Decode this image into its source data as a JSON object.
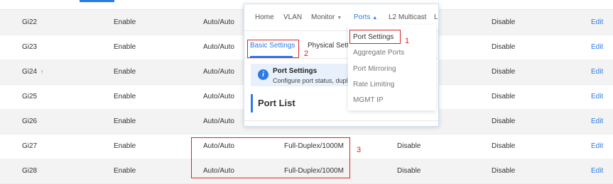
{
  "rows": [
    {
      "port": "Gi22",
      "enable": "Enable",
      "speed": "Auto/Auto",
      "duplex": "",
      "flow": "",
      "status": "Disable",
      "action": "Edit"
    },
    {
      "port": "Gi23",
      "enable": "Enable",
      "speed": "Auto/Auto",
      "duplex": "",
      "flow": "",
      "status": "Disable",
      "action": "Edit"
    },
    {
      "port": "Gi24",
      "enable": "Enable",
      "speed": "Auto/Auto",
      "duplex": "",
      "flow": "",
      "status": "Disable",
      "action": "Edit",
      "uplink": true
    },
    {
      "port": "Gi25",
      "enable": "Enable",
      "speed": "Auto/Auto",
      "duplex": "",
      "flow": "",
      "status": "Disable",
      "action": "Edit"
    },
    {
      "port": "Gi26",
      "enable": "Enable",
      "speed": "Auto/Auto",
      "duplex": "",
      "flow": "",
      "status": "Disable",
      "action": "Edit"
    },
    {
      "port": "Gi27",
      "enable": "Enable",
      "speed": "Auto/Auto",
      "duplex": "Full-Duplex/1000M",
      "flow": "Disable",
      "status": "Disable",
      "action": "Edit"
    },
    {
      "port": "Gi28",
      "enable": "Enable",
      "speed": "Auto/Auto",
      "duplex": "Full-Duplex/1000M",
      "flow": "Disable",
      "status": "Disable",
      "action": "Edit"
    }
  ],
  "nav": {
    "items": [
      "Home",
      "VLAN",
      "Monitor",
      "Ports",
      "L2 Multicast",
      "L"
    ],
    "active": "Ports"
  },
  "subtabs": {
    "basic": "Basic Settings",
    "physical": "Physical Settin"
  },
  "info": {
    "title": "Port Settings",
    "desc": "Configure port status, duple"
  },
  "port_list_title": "Port List",
  "dropdown": [
    "Port Settings",
    "Aggregate Ports",
    "Port Mirroring",
    "Rate Limiting",
    "MGMT IP"
  ],
  "annotations": {
    "n1": "1",
    "n2": "2",
    "n3": "3"
  },
  "icons": {
    "info": "info-icon",
    "uplink": "uplink-arrow-icon",
    "caret": "chevron-down-icon"
  },
  "colors": {
    "accent": "#2c7be5",
    "annotation": "#e02020",
    "row_stripe": "#f3f3f3"
  }
}
